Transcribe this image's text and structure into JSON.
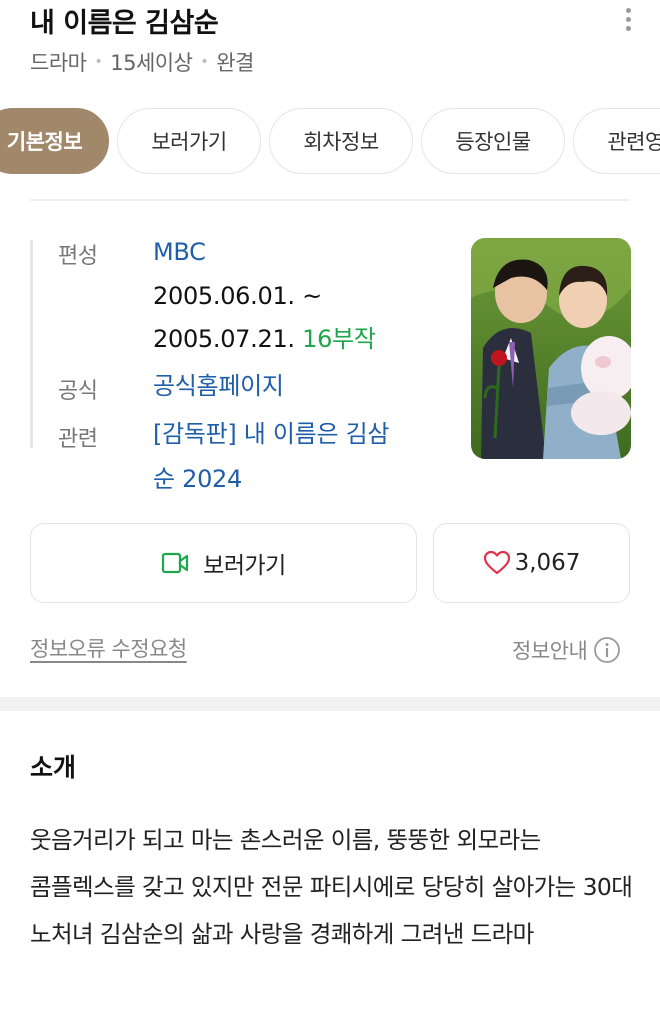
{
  "header": {
    "title": "내 이름은 김삼순",
    "meta": [
      "드라마",
      "15세이상",
      "완결"
    ]
  },
  "tabs": [
    {
      "label": "기본정보",
      "active": true
    },
    {
      "label": "보러가기",
      "active": false
    },
    {
      "label": "회차정보",
      "active": false
    },
    {
      "label": "등장인물",
      "active": false
    },
    {
      "label": "관련영상",
      "active": false
    }
  ],
  "info": {
    "broadcast_label": "편성",
    "broadcast_value": "MBC",
    "period_start": "2005.06.01. ~",
    "period_end": "2005.07.21.",
    "episodes": "16부작",
    "official_label": "공식",
    "official_value": "공식홈페이지",
    "related_label": "관련",
    "related_line1": "[감독판] 내 이름은 김삼",
    "related_line2": "순 2024"
  },
  "actions": {
    "watch_label": "보러가기",
    "like_count": "3,067"
  },
  "footer_links": {
    "report": "정보오류 수정요청",
    "guide": "정보안내"
  },
  "intro": {
    "title": "소개",
    "text": "웃음거리가 되고 마는 촌스러운 이름, 뚱뚱한 외모라는 콤플렉스를 갖고 있지만 전문 파티시에로 당당히 살아가는 30대 노처녀 김삼순의 삶과 사랑을 경쾌하게 그려낸 드라마"
  },
  "colors": {
    "accent_tab": "#a2886a",
    "link": "#1f5ea8",
    "green": "#1ea64a",
    "heart": "#e0324b"
  }
}
